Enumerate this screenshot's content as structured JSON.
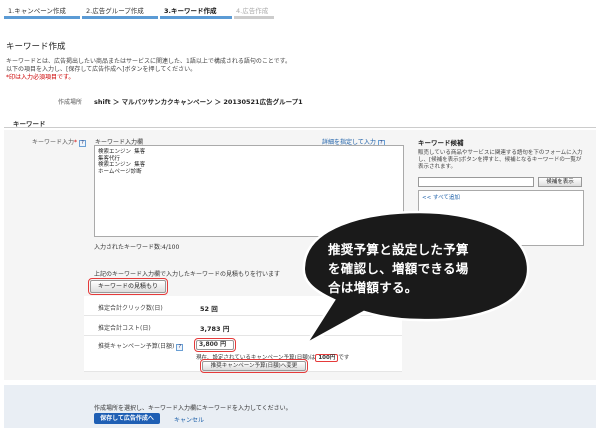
{
  "steps": [
    {
      "label": "1.キャンペーン作成",
      "state": "done"
    },
    {
      "label": "2.広告グループ作成",
      "state": "done"
    },
    {
      "label": "3.キーワード作成",
      "state": "active"
    },
    {
      "label": "4.広告作成",
      "state": "disabled"
    }
  ],
  "page": {
    "title": "キーワード作成",
    "desc1": "キーワードとは、広告掲出したい商品またはサービスに関連した、1語以上で構成される語句のことです。",
    "desc2": "以下の項目を入力し、[保存して広告作成へ]ボタンを押してください。",
    "required_note": "*印は入力必須項目です。"
  },
  "location": {
    "label": "作成場所",
    "path": "shift ＞ マルバツサンカクキャンペーン ＞ 20130521広告グループ1"
  },
  "section": {
    "title": "キーワード"
  },
  "keyword": {
    "label": "キーワード入力",
    "required_mark": "*",
    "help": "?",
    "field_label": "キーワード入力欄",
    "detail_link": "詳細を指定して入力",
    "text": "検索エンジン 集客\n集客代行\n検索エンジン 集客\nホームページ診断",
    "count": "入力されたキーワード数:4/100"
  },
  "candidates": {
    "title": "キーワード候補",
    "desc": "販売している商品やサービスに関連する語句を下のフォームに入力し、[候補を表示]ボタンを押すと、候補となるキーワードの一覧が表示されます。",
    "button": "候補を表示",
    "add_all": "<< すべて追加"
  },
  "estimate": {
    "note": "上記のキーワード入力欄で入力したキーワードの見積もりを行います",
    "button": "キーワードの見積もり",
    "clicks_label": "推定合計クリック数(日)",
    "clicks_value": "52 回",
    "cost_label": "推定合計コスト(日)",
    "cost_value": "3,783 円",
    "budget_label": "推奨キャンペーン予算(日額)",
    "budget_value": "3,800 円",
    "current_prefix": "現在、設定されているキャンペーン予算(日額)は",
    "current_amount": "100円",
    "current_suffix": "です",
    "change_button": "推奨キャンペーン予算(日額)へ変更"
  },
  "footer": {
    "note": "作成場所を選択し、キーワード入力欄にキーワードを入力してください。",
    "save": "保存して広告作成へ",
    "cancel": "キャンセル"
  },
  "callout": {
    "line1": "推奨予算と設定した予算",
    "line2": "を確認し、増額できる場",
    "line3": "合は増額する。"
  },
  "colors": {
    "accent": "#1f5fb4",
    "highlight": "#e53a3a",
    "step_bar": "#5b9bd5",
    "callout_fill": "#1a1a1a"
  }
}
